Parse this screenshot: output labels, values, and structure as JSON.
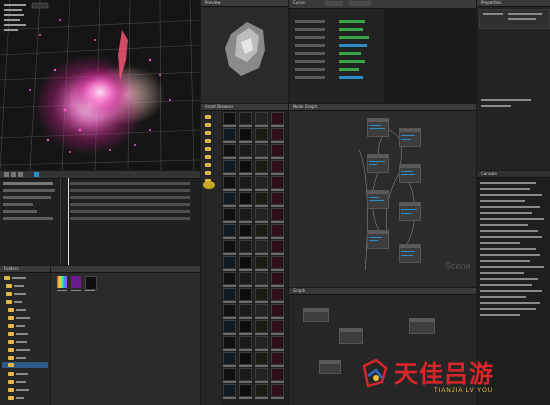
{
  "app": {
    "watermark_brand": "天佳吕游",
    "watermark_sub": "TIANJIA LV YOU",
    "node_graph_watermark": "Scene"
  },
  "colors": {
    "accent": "#2c8cc4",
    "panel": "#262626",
    "header": "#3a3a3a",
    "folder": "#e0b94a",
    "particle_glow": "#ff4fc8",
    "watermark_red": "#d9262b"
  },
  "viewport": {
    "tab_label": "Viewport"
  },
  "preview": {
    "tab_label": "Preview"
  },
  "curve_editor": {
    "tab_label": "Curve"
  },
  "properties": {
    "tab_label": "Properties"
  },
  "asset_browser": {
    "tab_label": "Asset Browser"
  },
  "node_graph": {
    "tab_label": "Node Graph"
  },
  "console": {
    "tab_label": "Console"
  },
  "timeline": {
    "tab_label": "Timeline"
  },
  "folder_tree": {
    "tab_label": "Folders"
  },
  "bottom_graph": {
    "tab_label": "Graph"
  }
}
